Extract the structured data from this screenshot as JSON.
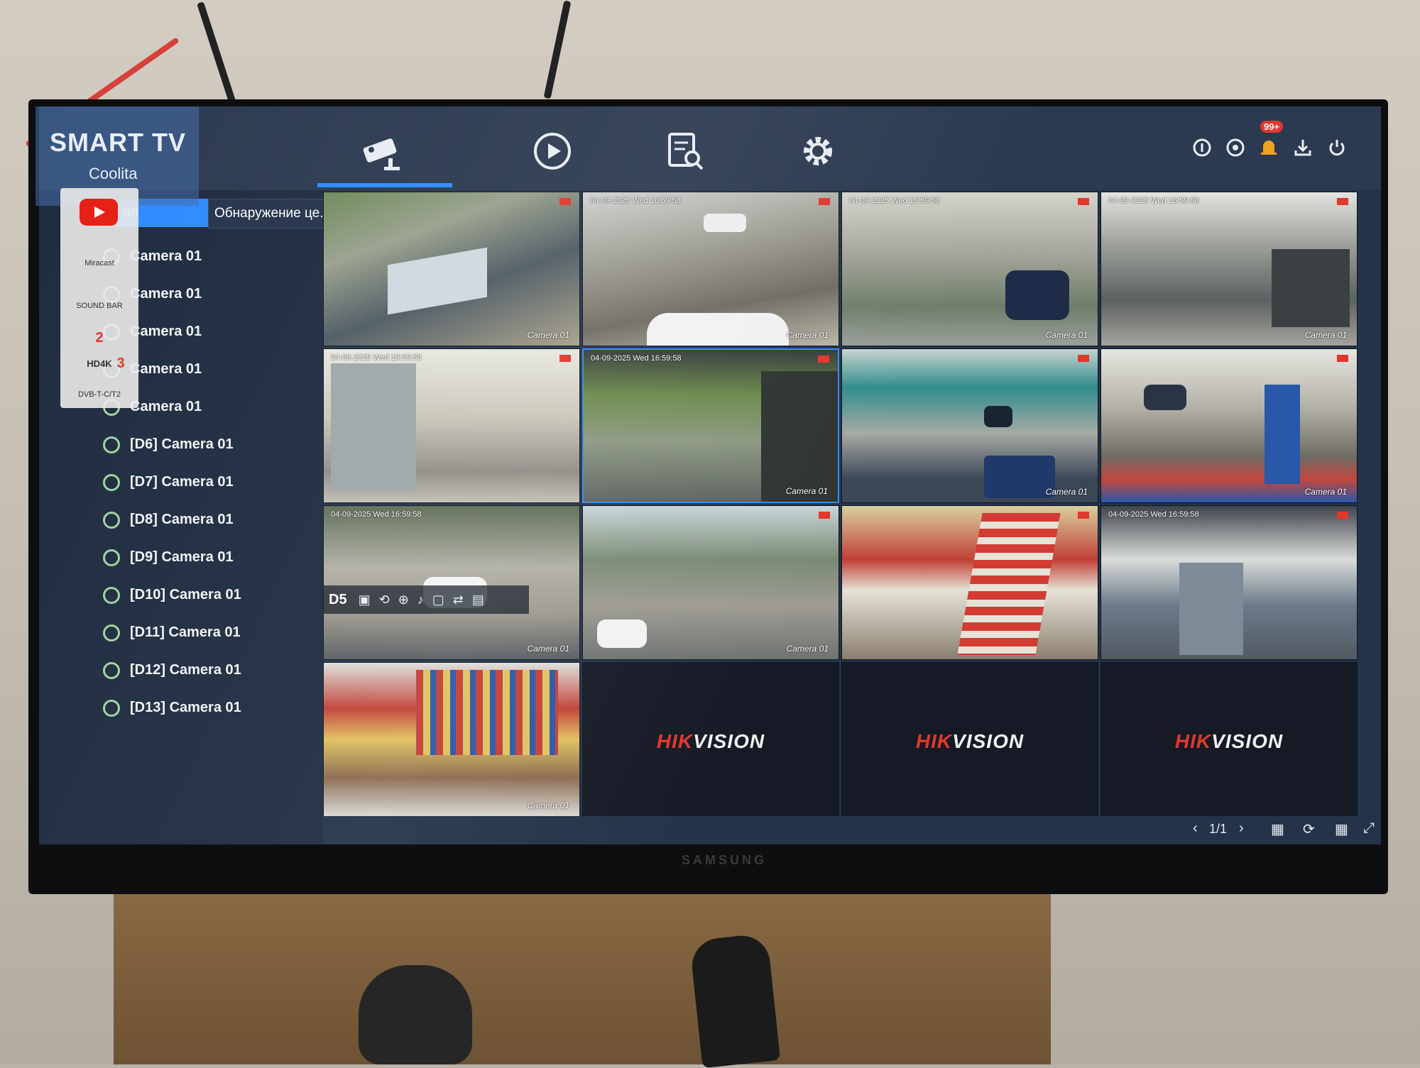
{
  "tv": {
    "sticker_title": "SMART TV",
    "sticker_brand": "Coolita",
    "features": [
      "Miracast",
      "SOUND BAR",
      "2",
      "HD4K",
      "3",
      "DVB-T-C/T2"
    ],
    "bezel_brand": "SAMSUNG"
  },
  "toolbar": {
    "tabs": [
      {
        "icon": "camera-icon",
        "label": ""
      },
      {
        "icon": "playback-icon",
        "label": ""
      },
      {
        "icon": "search-file-icon",
        "label": ""
      },
      {
        "icon": "gear-icon",
        "label": ""
      }
    ],
    "right_icons": [
      "info-icon",
      "target-icon",
      "bell-icon",
      "download-icon",
      "power-icon"
    ],
    "alarm_badge": "99+"
  },
  "panel": {
    "tab_active": "ал",
    "tab_second": "Обнаружение це...",
    "cameras": [
      "Camera 01",
      "Camera 01",
      "Camera 01",
      "Camera 01",
      "Camera 01",
      "[D6] Camera 01",
      "[D7] Camera 01",
      "[D8] Camera 01",
      "[D9] Camera 01",
      "[D10] Camera 01",
      "[D11] Camera 01",
      "[D12] Camera 01",
      "[D13] Camera 01"
    ]
  },
  "grid": {
    "cell_label": "Camera 01",
    "timestamp": "04-09-2025 Wed 16:59:58",
    "selected_tile_label": "D5",
    "brand_red": "HIK",
    "brand_white": "VISION"
  },
  "bottom": {
    "page": "1/1"
  },
  "colors": {
    "accent": "#2e8bff",
    "panel_bg": "#1f2b3f",
    "brand_red": "#e2372b"
  }
}
